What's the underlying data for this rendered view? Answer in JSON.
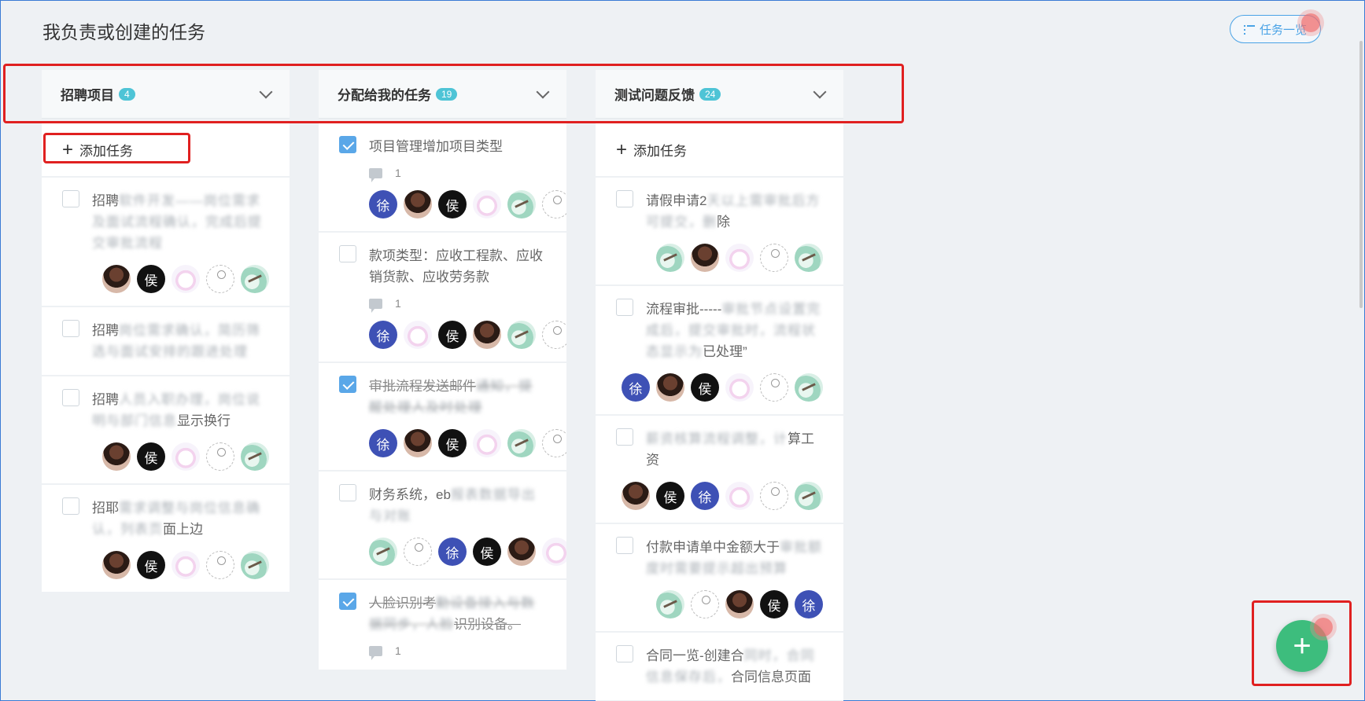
{
  "header": {
    "title": "我负责或创建的任务",
    "list_button_label": "任务一览"
  },
  "add_task_label": "添加任务",
  "columns": [
    {
      "title": "招聘项目",
      "count": "4",
      "show_add": true,
      "cards": [
        {
          "checked": false,
          "text": "招聘",
          "blurred": "软件开发——岗位需求及面试流程确认，完成后提交审批流程",
          "avatars": [
            "portrait",
            "hou",
            "cat",
            "sketch",
            "bird"
          ]
        },
        {
          "checked": false,
          "text": "招聘",
          "blurred": "岗位需求确认，简历筛选与面试安排的跟进处理",
          "avatars": []
        },
        {
          "checked": false,
          "text": "招聘",
          "blurred": "人员入职办理，岗位说明与部门信息",
          "tail": "显示换行",
          "avatars": [
            "portrait",
            "hou",
            "cat",
            "sketch",
            "bird"
          ]
        },
        {
          "checked": false,
          "text": "招耶",
          "blurred": "需求调整与岗位信息确认，列表页",
          "tail": "面上边",
          "avatars": [
            "portrait",
            "hou",
            "cat",
            "sketch",
            "bird"
          ]
        }
      ]
    },
    {
      "title": "分配给我的任务",
      "count": "19",
      "show_add": false,
      "cards": [
        {
          "checked": true,
          "text": "项目管理增加项目类型",
          "blurred": "",
          "comments": "1",
          "avatars": [
            "xu",
            "portrait",
            "hou",
            "cat",
            "bird",
            "sketch"
          ]
        },
        {
          "checked": false,
          "text": "款项类型：应收工程款、应收销货款、应收劳务款",
          "blurred": "",
          "comments": "1",
          "avatars": [
            "xu",
            "cat",
            "hou",
            "portrait",
            "bird",
            "sketch"
          ]
        },
        {
          "checked": true,
          "text": "审批流程发送邮件",
          "blurred": "通知，提醒处理人及时处理",
          "avatars": [
            "xu",
            "portrait",
            "hou",
            "cat",
            "bird",
            "sketch"
          ]
        },
        {
          "checked": false,
          "text": "财务系统，eb",
          "blurred": "报表数据导出与对账",
          "avatars": [
            "bird",
            "sketch",
            "xu",
            "hou",
            "portrait",
            "cat"
          ]
        },
        {
          "checked": true,
          "text": "人脸识别考",
          "blurred": "勤设备接入与数据同步，人脸",
          "tail": "识别设备。",
          "comments": "1",
          "avatars": []
        }
      ]
    },
    {
      "title": "测试问题反馈",
      "count": "24",
      "show_add": true,
      "cards": [
        {
          "checked": false,
          "text": "请假申请2",
          "blurred": "天以上需审批后方可提交，删",
          "tail": "除",
          "avatars": [
            "bird",
            "portrait",
            "cat",
            "sketch",
            "bird"
          ]
        },
        {
          "checked": false,
          "text": "流程审批-----",
          "blurred": "审批节点设置完成后，提交审批时，流程状态显示为",
          "tail": "已处理”",
          "avatars": [
            "xu",
            "portrait",
            "hou",
            "cat",
            "sketch",
            "bird"
          ]
        },
        {
          "checked": false,
          "text": "",
          "blurred": "薪资核算流程调整，计",
          "tail": "算工资",
          "avatars": [
            "portrait",
            "hou",
            "xu",
            "cat",
            "sketch",
            "bird"
          ]
        },
        {
          "checked": false,
          "text": "付款申请单中金额大于",
          "blurred": "审批额度时需要提示超出预算",
          "avatars": [
            "bird",
            "sketch",
            "portrait",
            "hou",
            "xu"
          ]
        },
        {
          "checked": false,
          "text": "合同一览-创建合",
          "blurred": "同时，合同信息保存后，",
          "tail": "合同信息页面",
          "avatars": []
        }
      ]
    }
  ],
  "avatar_letters": {
    "xu": "徐",
    "hou": "侯"
  },
  "fab_label": "+",
  "colors": {
    "accent": "#4aa3e6",
    "badge": "#4ec4d6",
    "fab": "#3dbd7d",
    "highlight_box": "#e02020"
  }
}
